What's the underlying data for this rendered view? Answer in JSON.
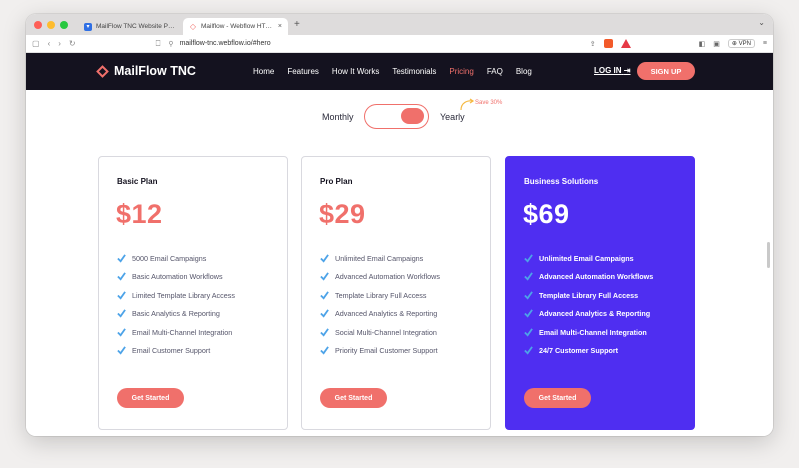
{
  "browser": {
    "tabs": [
      {
        "title": "MailFlow TNC Website Page Tem…",
        "active": false,
        "favicon_color": "#2f6fe4"
      },
      {
        "title": "Mailflow - Webflow HTML w…",
        "active": true,
        "favicon_color": "#f0706b"
      }
    ],
    "url": "mailflow-tnc.webflow.io/#hero",
    "vpn_label": "VPN",
    "new_tab_label": "+",
    "close_label": "×"
  },
  "site": {
    "brand": "MailFlow TNC",
    "nav": [
      "Home",
      "Features",
      "How It Works",
      "Testimonials",
      "Pricing",
      "FAQ",
      "Blog"
    ],
    "active_nav": "Pricing",
    "login_label": "LOG IN",
    "signup_label": "SIGN UP"
  },
  "billing": {
    "monthly_label": "Monthly",
    "yearly_label": "Yearly",
    "save_badge": "Save 30%",
    "selected": "Yearly"
  },
  "plans": [
    {
      "name": "Basic Plan",
      "price": "$12",
      "features": [
        "5000 Email Campaigns",
        "Basic Automation Workflows",
        "Limited Template Library Access",
        "Basic Analytics & Reporting",
        "Email Multi-Channel Integration",
        "Email Customer Support"
      ],
      "cta": "Get Started"
    },
    {
      "name": "Pro Plan",
      "price": "$29",
      "features": [
        "Unlimited Email Campaigns",
        "Advanced Automation Workflows",
        "Template Library Full Access",
        "Advanced Analytics & Reporting",
        "Social Multi-Channel Integration",
        "Priority Email Customer Support"
      ],
      "cta": "Get Started"
    },
    {
      "name": "Business Solutions",
      "price": "$69",
      "features": [
        "Unlimited Email Campaigns",
        "Advanced Automation Workflows",
        "Template Library Full Access",
        "Advanced Analytics & Reporting",
        "Email Multi-Channel Integration",
        "24/7 Customer Support"
      ],
      "cta": "Get Started"
    }
  ],
  "colors": {
    "accent": "#f0706b",
    "nav_bg": "#14121f",
    "featured_bg": "#4f2ef1",
    "check": "#4da3e8"
  }
}
